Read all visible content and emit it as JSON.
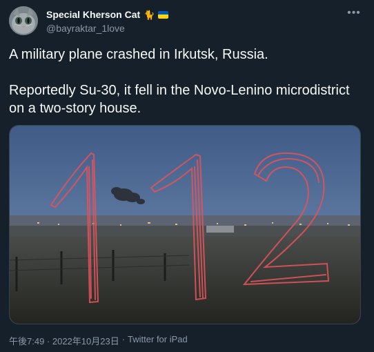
{
  "author": {
    "display_name": "Special Kherson Cat",
    "emoji_cat": "🐈",
    "flag_colors": [
      "#0057b7",
      "#ffd700"
    ],
    "handle": "@bayraktar_1love"
  },
  "more_icon": "•••",
  "tweet": {
    "paragraph_1": "A military plane crashed in Irkutsk, Russia.",
    "paragraph_2": "Reportedly Su-30, it fell in the Novo-Lenino microdistrict on a two-story house."
  },
  "media": {
    "overlay_text": "112"
  },
  "meta": {
    "timestamp": "午後7:49 · 2022年10月23日",
    "separator": "·",
    "source": "Twitter for iPad"
  },
  "colors": {
    "background": "#15202b",
    "text": "#f7f9f9",
    "secondary": "#8b98a5",
    "border": "#38444d",
    "overlay_red": "#e0545c"
  }
}
